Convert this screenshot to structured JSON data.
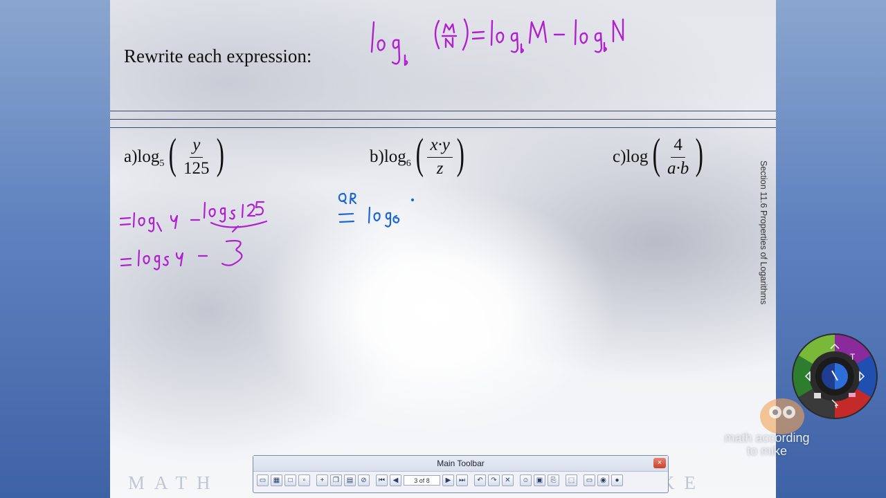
{
  "slide": {
    "title": "Rewrite each expression:",
    "section_label": "Section 11.6 Properties of Logarithms",
    "watermark_left": "MATH",
    "watermark_right": "IKE",
    "problems": [
      {
        "label": "a)",
        "fn": "log",
        "base": "5",
        "numerator": "y",
        "denominator": "125"
      },
      {
        "label": "b)",
        "fn": "log",
        "base": "6",
        "numerator": "x·y",
        "denominator": "z"
      },
      {
        "label": "c)",
        "fn": "log",
        "base": "",
        "numerator": "4",
        "denominator": "a·b"
      }
    ],
    "ink_colors": {
      "purple": "#b01fd0",
      "blue": "#1a66d6"
    }
  },
  "toolbar": {
    "title": "Main Toolbar",
    "close_label": "×",
    "page_indicator": "3 of 8"
  },
  "branding": {
    "line1": "math according",
    "line2": "to mike"
  },
  "wheel": {
    "center_colors": [
      "#1f3e8f",
      "#2c6fd8"
    ],
    "ring_colors": [
      "#2e7d2e",
      "#7ab83a",
      "#8b2a9b",
      "#c42a2a",
      "#1f4fb0"
    ]
  }
}
